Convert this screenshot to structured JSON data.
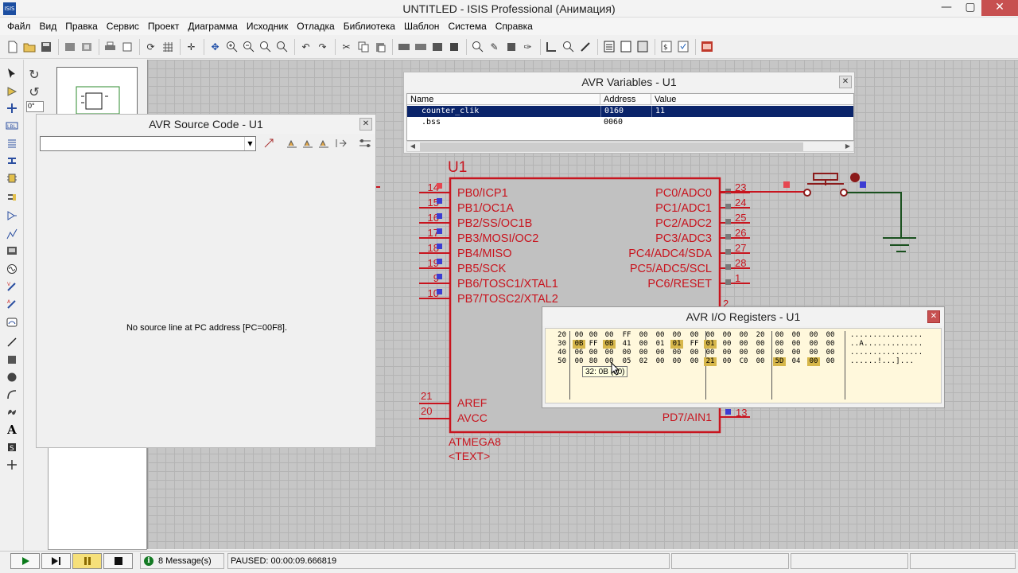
{
  "window": {
    "title": "UNTITLED - ISIS Professional (Анимация)",
    "icon_label": "ISIS",
    "controls": [
      "minimize-icon",
      "maximize-icon",
      "close-icon"
    ]
  },
  "menu": [
    "Файл",
    "Вид",
    "Правка",
    "Сервис",
    "Проект",
    "Диаграмма",
    "Исходник",
    "Отладка",
    "Библиотека",
    "Шаблон",
    "Система",
    "Справка"
  ],
  "toolbar_icons": [
    "new-file-icon",
    "open-folder-icon",
    "save-icon",
    "import-icon",
    "export-icon",
    "print-icon",
    "print-area-icon",
    "refresh-icon",
    "grid-icon",
    "origin-icon",
    "pan-icon",
    "zoom-in-icon",
    "zoom-out-icon",
    "zoom-all-icon",
    "zoom-area-icon",
    "undo-icon",
    "redo-icon",
    "cut-icon",
    "copy-icon",
    "paste-icon",
    "block-copy-icon",
    "block-move-icon",
    "block-rotate-icon",
    "block-delete-icon",
    "pick-device-icon",
    "make-device-icon",
    "packaging-icon",
    "decompose-icon",
    "wire-autorouter-icon",
    "search-tag-icon",
    "property-tool-icon",
    "new-sheet-icon",
    "remove-sheet-icon",
    "exit-to-parent-icon",
    "bom-icon",
    "electrical-check-icon",
    "netlist-to-ares-icon"
  ],
  "angle_field": "0°",
  "source_window": {
    "title": "AVR Source Code - U1",
    "message": "No source line at PC address [PC=00F8]."
  },
  "variables_window": {
    "title": "AVR Variables - U1",
    "columns": [
      "Name",
      "Address",
      "Value"
    ],
    "rows": [
      {
        "name": "counter_clik",
        "address": "0160",
        "value": "11"
      },
      {
        "name": ".bss",
        "address": "0060",
        "value": ""
      }
    ]
  },
  "io_window": {
    "title": "AVR I/O Registers - U1",
    "rows": [
      {
        "addr": "20",
        "bytes": [
          "00",
          "00",
          "00",
          "FF",
          "00",
          "00",
          "00",
          "00",
          "00",
          "00",
          "00",
          "20",
          "00",
          "00",
          "00",
          "00"
        ],
        "ascii": "................"
      },
      {
        "addr": "30",
        "bytes": [
          "0B",
          "FF",
          "0B",
          "41",
          "00",
          "01",
          "01",
          "FF",
          "01",
          "00",
          "00",
          "00",
          "00",
          "00",
          "00",
          "00"
        ],
        "ascii": "..A............."
      },
      {
        "addr": "40",
        "bytes": [
          "06",
          "00",
          "00",
          "00",
          "00",
          "00",
          "00",
          "00",
          "00",
          "00",
          "00",
          "00",
          "00",
          "00",
          "00",
          "00"
        ],
        "ascii": "................"
      },
      {
        "addr": "50",
        "bytes": [
          "00",
          "80",
          "00",
          "05",
          "02",
          "00",
          "00",
          "00",
          "21",
          "00",
          "C0",
          "00",
          "5D",
          "04",
          "00",
          "00"
        ],
        "ascii": "......!...].\u0004.."
      }
    ],
    "highlights": [
      [
        1,
        0
      ],
      [
        1,
        2
      ],
      [
        1,
        6
      ],
      [
        1,
        8
      ],
      [
        3,
        8
      ],
      [
        3,
        12
      ],
      [
        3,
        14
      ]
    ],
    "tooltip": "32: 0B (00)"
  },
  "schematic": {
    "ref": "U1",
    "part": "ATMEGA8",
    "text_placeholder": "<TEXT>",
    "left_pins": [
      {
        "num": "14",
        "name": "PB0/ICP1"
      },
      {
        "num": "15",
        "name": "PB1/OC1A"
      },
      {
        "num": "16",
        "name": "PB2/SS/OC1B"
      },
      {
        "num": "17",
        "name": "PB3/MOSI/OC2"
      },
      {
        "num": "18",
        "name": "PB4/MISO"
      },
      {
        "num": "19",
        "name": "PB5/SCK"
      },
      {
        "num": "9",
        "name": "PB6/TOSC1/XTAL1"
      },
      {
        "num": "10",
        "name": "PB7/TOSC2/XTAL2"
      }
    ],
    "right_pins": [
      {
        "num": "23",
        "name": "PC0/ADC0"
      },
      {
        "num": "24",
        "name": "PC1/ADC1"
      },
      {
        "num": "25",
        "name": "PC2/ADC2"
      },
      {
        "num": "26",
        "name": "PC3/ADC3"
      },
      {
        "num": "27",
        "name": "PC4/ADC4/SDA"
      },
      {
        "num": "28",
        "name": "PC5/ADC5/SCL"
      },
      {
        "num": "1",
        "name": "PC6/RESET"
      }
    ],
    "partial_pin_num": "2",
    "aref": {
      "num": "21",
      "name": "AREF"
    },
    "avcc": {
      "num": "20",
      "name": "AVCC"
    },
    "pd7": {
      "num": "13",
      "name": "PD7/AIN1"
    },
    "colors": {
      "component": "#c8141e",
      "wire_green": "#19501e",
      "pin_blue": "#3c3cd2",
      "pin_gray": "#7a7a7a",
      "pin_red": "#e64650"
    }
  },
  "status": {
    "messages": "8 Message(s)",
    "sim_status": "PAUSED: 00:00:09.666819"
  }
}
